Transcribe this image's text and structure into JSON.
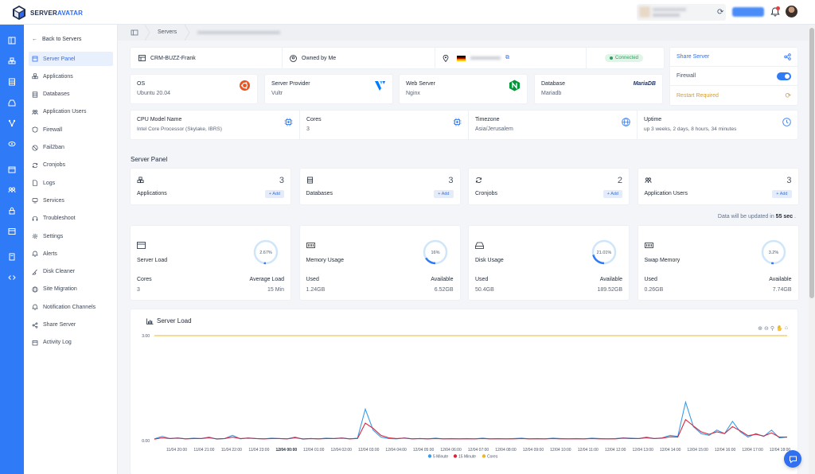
{
  "brand": {
    "part1": "SERVER",
    "part2": "AVATAR"
  },
  "sidebar": {
    "back_label": "Back to Servers",
    "items": [
      {
        "label": "Server Panel",
        "icon": "server-icon"
      },
      {
        "label": "Applications",
        "icon": "cubes-icon"
      },
      {
        "label": "Databases",
        "icon": "database-icon"
      },
      {
        "label": "Application Users",
        "icon": "users-icon"
      },
      {
        "label": "Firewall",
        "icon": "shield-icon"
      },
      {
        "label": "Fail2ban",
        "icon": "ban-icon"
      },
      {
        "label": "Cronjobs",
        "icon": "refresh-icon"
      },
      {
        "label": "Logs",
        "icon": "file-icon"
      },
      {
        "label": "Services",
        "icon": "services-icon"
      },
      {
        "label": "Troubleshoot",
        "icon": "headset-icon"
      },
      {
        "label": "Settings",
        "icon": "gear-icon"
      },
      {
        "label": "Alerts",
        "icon": "bell-icon"
      },
      {
        "label": "Disk Cleaner",
        "icon": "broom-icon"
      },
      {
        "label": "Site Migration",
        "icon": "globe-icon"
      },
      {
        "label": "Notification Channels",
        "icon": "bell-icon"
      },
      {
        "label": "Share Server",
        "icon": "share-icon"
      },
      {
        "label": "Activity Log",
        "icon": "calendar-icon"
      }
    ]
  },
  "breadcrumb": {
    "servers": "Servers"
  },
  "summary": {
    "server_name": "CRM-BUZZ-Frank",
    "owner": "Owned by Me",
    "status": "Connected"
  },
  "side_card": {
    "share_label": "Share Server",
    "firewall_label": "Firewall",
    "restart_label": "Restart Required",
    "share_color": "#2f6ff0",
    "restart_color": "#d69e2e"
  },
  "info": {
    "os": {
      "label": "OS",
      "value": "Ubuntu 20.04"
    },
    "provider": {
      "label": "Server Provider",
      "value": "Vultr"
    },
    "webserver": {
      "label": "Web Server",
      "value": "Nginx"
    },
    "database": {
      "label": "Database",
      "value": "Mariadb",
      "logo": "MariaDB"
    },
    "cpu": {
      "label": "CPU Model Name",
      "value": "Intel Core Processor (Skylake, IBRS)"
    },
    "cores": {
      "label": "Cores",
      "value": "3"
    },
    "timezone": {
      "label": "Timezone",
      "value": "Asia/Jerusalem"
    },
    "uptime": {
      "label": "Uptime",
      "value": "up 3 weeks, 2 days, 8 hours, 34 minutes"
    }
  },
  "panel": {
    "title": "Server Panel",
    "add_label": "+ Add",
    "counters": [
      {
        "label": "Applications",
        "count": "3"
      },
      {
        "label": "Databases",
        "count": "3"
      },
      {
        "label": "Cronjobs",
        "count": "2"
      },
      {
        "label": "Application Users",
        "count": "3"
      }
    ]
  },
  "update_note": {
    "text": "Data will be updated in",
    "seconds": "55 sec",
    "suffix": "."
  },
  "metrics": [
    {
      "title": "Server Load",
      "percent_label": "2.67%",
      "percent": 2.67,
      "l1": "Cores",
      "r1": "Average Load",
      "l2": "3",
      "r2": "15 Min"
    },
    {
      "title": "Memory Usage",
      "percent_label": "16%",
      "percent": 16,
      "l1": "Used",
      "r1": "Available",
      "l2": "1.24GB",
      "r2": "6.52GB"
    },
    {
      "title": "Disk Usage",
      "percent_label": "21.01%",
      "percent": 21.01,
      "l1": "Used",
      "r1": "Available",
      "l2": "50.4GB",
      "r2": "189.52GB"
    },
    {
      "title": "Swap Memory",
      "percent_label": "3.2%",
      "percent": 3.2,
      "l1": "Used",
      "r1": "Available",
      "l2": "0.26GB",
      "r2": "7.74GB"
    }
  ],
  "chart_data": {
    "type": "line",
    "title": "Server Load",
    "ylim": [
      0,
      3
    ],
    "y_ticks": [
      "3.00",
      "0.00"
    ],
    "x": [
      "11/04 20:00",
      "11/04 21:00",
      "11/04 22:00",
      "11/04 23:00",
      "12/04 00:00",
      "12/04 01:00",
      "12/04 02:00",
      "12/04 03:00",
      "12/04 04:00",
      "12/04 05:00",
      "12/04 06:00",
      "12/04 07:00",
      "12/04 08:00",
      "12/04 09:00",
      "12/04 10:00",
      "12/04 11:00",
      "12/04 12:00",
      "12/04 13:00",
      "12/04 14:00",
      "12/04 15:00",
      "12/04 16:00",
      "12/04 17:00",
      "12/04 18:00"
    ],
    "series": [
      {
        "name": "5 Minute",
        "color": "#3b9be8",
        "values": [
          0.05,
          0.12,
          0.06,
          0.08,
          0.05,
          0.07,
          0.06,
          0.1,
          0.04,
          0.06,
          0.15,
          0.05,
          0.08,
          0.06,
          0.05,
          0.07,
          0.06,
          0.05,
          0.1,
          0.04,
          0.06,
          0.05,
          0.07,
          0.06,
          0.08,
          0.05,
          0.07,
          0.9,
          0.3,
          0.1,
          0.06,
          0.05,
          0.08,
          0.05,
          0.06,
          0.05,
          0.07,
          0.05,
          0.06,
          0.05,
          0.06,
          0.05,
          0.07,
          0.05,
          0.06,
          0.05,
          0.06,
          0.07,
          0.05,
          0.06,
          0.05,
          0.07,
          0.06,
          0.05,
          0.06,
          0.05,
          0.07,
          0.06,
          0.05,
          0.06,
          0.08,
          0.07,
          0.06,
          0.1,
          0.06,
          0.08,
          0.15,
          0.12,
          1.1,
          0.4,
          0.2,
          0.15,
          0.3,
          0.2,
          0.55,
          0.25,
          0.1,
          0.2,
          0.12,
          0.3,
          0.08,
          0.1
        ]
      },
      {
        "name": "15 Minute",
        "color": "#d7263d",
        "values": [
          0.04,
          0.08,
          0.06,
          0.07,
          0.05,
          0.06,
          0.06,
          0.08,
          0.05,
          0.06,
          0.1,
          0.06,
          0.07,
          0.06,
          0.05,
          0.06,
          0.06,
          0.05,
          0.08,
          0.05,
          0.06,
          0.05,
          0.06,
          0.06,
          0.07,
          0.05,
          0.06,
          0.5,
          0.35,
          0.15,
          0.08,
          0.06,
          0.07,
          0.05,
          0.06,
          0.05,
          0.06,
          0.05,
          0.05,
          0.05,
          0.05,
          0.05,
          0.06,
          0.05,
          0.05,
          0.05,
          0.05,
          0.06,
          0.05,
          0.05,
          0.05,
          0.06,
          0.05,
          0.05,
          0.05,
          0.05,
          0.06,
          0.05,
          0.05,
          0.05,
          0.07,
          0.06,
          0.06,
          0.08,
          0.06,
          0.07,
          0.11,
          0.1,
          0.6,
          0.42,
          0.25,
          0.18,
          0.25,
          0.2,
          0.4,
          0.28,
          0.14,
          0.18,
          0.13,
          0.22,
          0.1,
          0.1
        ]
      },
      {
        "name": "Cores",
        "color": "#f0b429",
        "values": [
          3,
          3
        ]
      }
    ]
  }
}
